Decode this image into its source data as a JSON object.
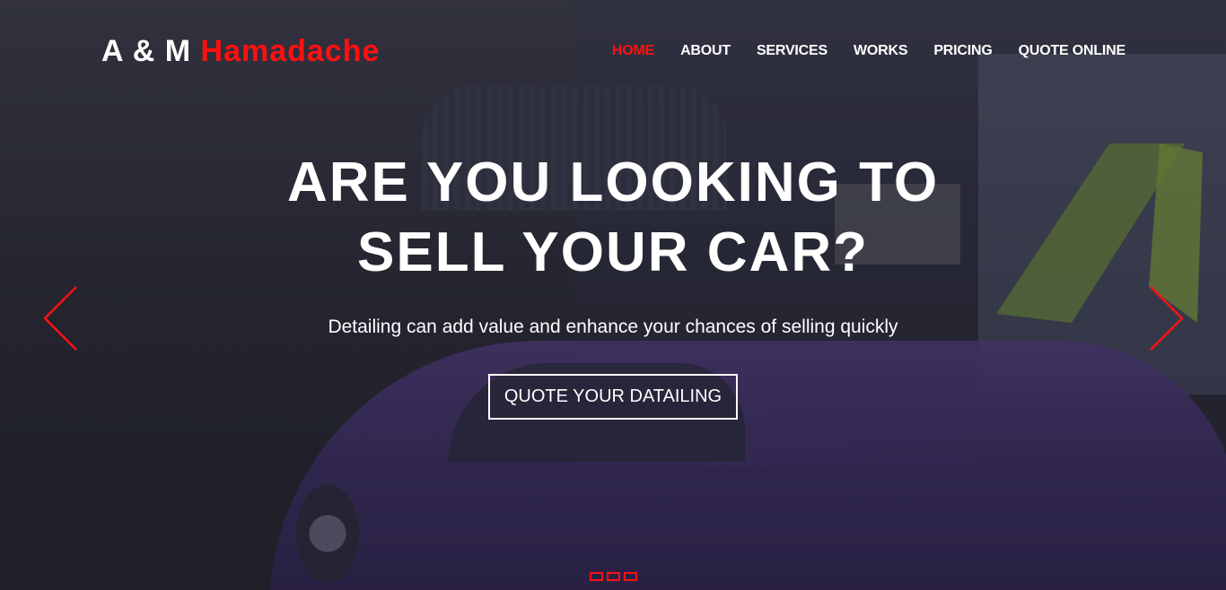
{
  "brand": {
    "part1": "A & M",
    "part2": "Hamadache",
    "accent_color": "#ff1010"
  },
  "nav": {
    "items": [
      {
        "label": "HOME",
        "active": true
      },
      {
        "label": "ABOUT",
        "active": false
      },
      {
        "label": "SERVICES",
        "active": false
      },
      {
        "label": "WORKS",
        "active": false
      },
      {
        "label": "PRICING",
        "active": false
      },
      {
        "label": "QUOTE ONLINE",
        "active": false
      }
    ]
  },
  "hero": {
    "headline_line1": "ARE YOU LOOKING TO",
    "headline_line2": "SELL YOUR CAR?",
    "subtext": "Detailing can add value and enhance your chances of selling quickly",
    "cta_label": "QUOTE YOUR DATAILING"
  },
  "carousel": {
    "prev_icon": "chevron-left-icon",
    "next_icon": "chevron-right-icon",
    "indicator_count": 3,
    "indicator_color": "#ff1010"
  }
}
